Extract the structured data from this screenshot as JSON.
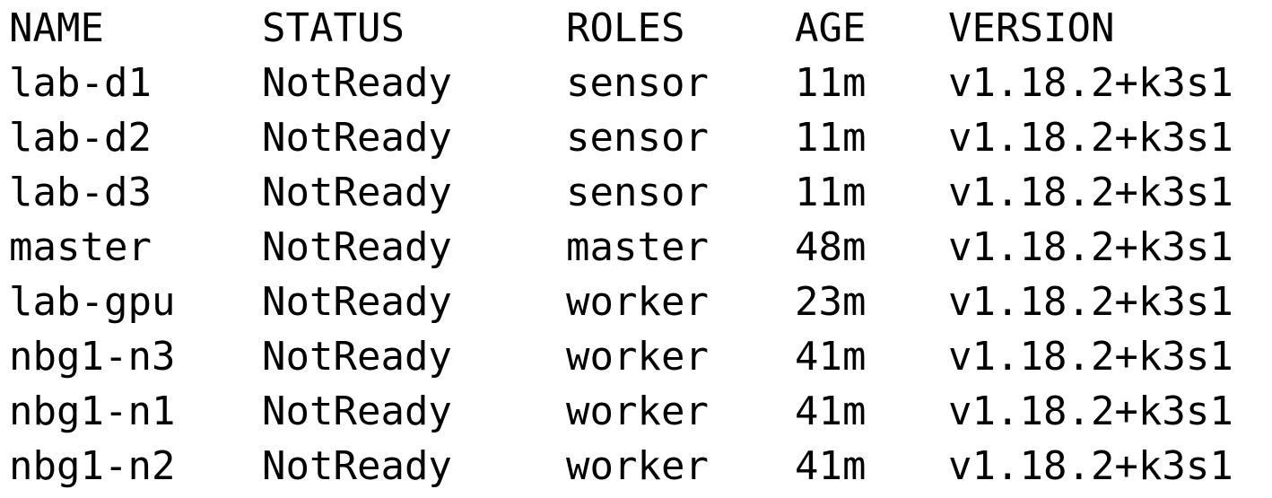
{
  "terminal": {
    "colors": {
      "background": "#ffffff",
      "text": "#000000"
    },
    "headers": {
      "name": "NAME",
      "status": "STATUS",
      "roles": "ROLES",
      "age": "AGE",
      "version": "VERSION"
    },
    "rows": [
      {
        "name": "lab-d1",
        "status": "NotReady",
        "roles": "sensor",
        "age": "11m",
        "version": "v1.18.2+k3s1"
      },
      {
        "name": "lab-d2",
        "status": "NotReady",
        "roles": "sensor",
        "age": "11m",
        "version": "v1.18.2+k3s1"
      },
      {
        "name": "lab-d3",
        "status": "NotReady",
        "roles": "sensor",
        "age": "11m",
        "version": "v1.18.2+k3s1"
      },
      {
        "name": "master",
        "status": "NotReady",
        "roles": "master",
        "age": "48m",
        "version": "v1.18.2+k3s1"
      },
      {
        "name": "lab-gpu",
        "status": "NotReady",
        "roles": "worker",
        "age": "23m",
        "version": "v1.18.2+k3s1"
      },
      {
        "name": "nbg1-n3",
        "status": "NotReady",
        "roles": "worker",
        "age": "41m",
        "version": "v1.18.2+k3s1"
      },
      {
        "name": "nbg1-n1",
        "status": "NotReady",
        "roles": "worker",
        "age": "41m",
        "version": "v1.18.2+k3s1"
      },
      {
        "name": "nbg1-n2",
        "status": "NotReady",
        "roles": "worker",
        "age": "41m",
        "version": "v1.18.2+k3s1"
      }
    ]
  }
}
